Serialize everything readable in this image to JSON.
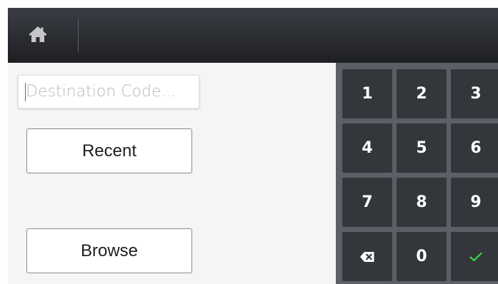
{
  "topbar": {
    "home_icon": "home-icon"
  },
  "destination": {
    "placeholder": "Destination Code...",
    "value": ""
  },
  "buttons": {
    "recent_label": "Recent",
    "browse_label": "Browse"
  },
  "keypad": {
    "keys": [
      "1",
      "2",
      "3",
      "4",
      "5",
      "6",
      "7",
      "8",
      "9",
      "",
      "0",
      ""
    ],
    "backspace_icon": "backspace-icon",
    "confirm_icon": "checkmark-icon",
    "confirm_color": "#3fd43f"
  },
  "colors": {
    "topbar": "#2a2c31",
    "background": "#f5f5f6",
    "keypad_panel": "#5c6066",
    "key": "#33363b"
  }
}
